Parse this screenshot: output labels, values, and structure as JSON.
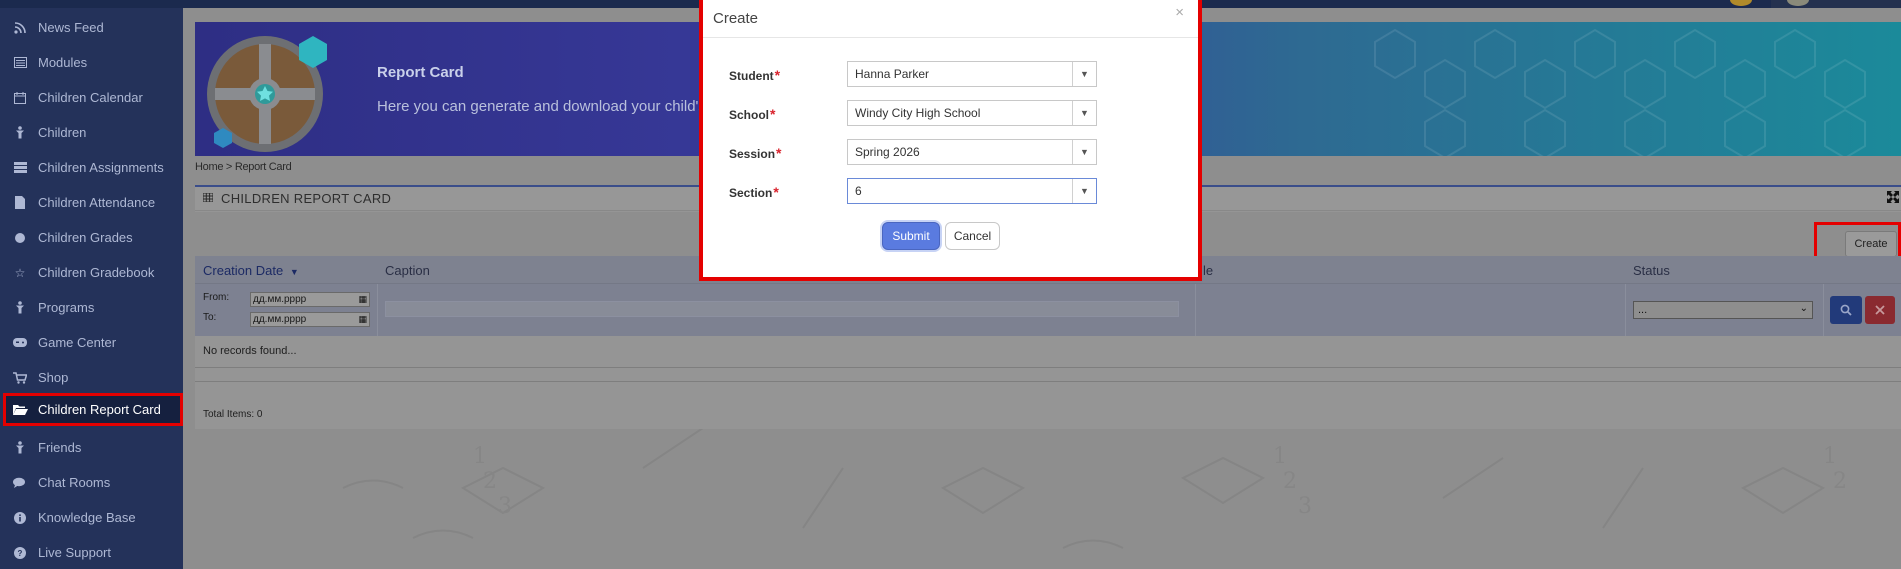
{
  "sidebar": {
    "items": [
      {
        "label": "News Feed",
        "icon": "rss-icon"
      },
      {
        "label": "Modules",
        "icon": "modules-icon"
      },
      {
        "label": "Children Calendar",
        "icon": "calendar-icon"
      },
      {
        "label": "Children",
        "icon": "child-icon"
      },
      {
        "label": "Children Assignments",
        "icon": "assignments-icon"
      },
      {
        "label": "Children Attendance",
        "icon": "attendance-icon"
      },
      {
        "label": "Children Grades",
        "icon": "grades-icon"
      },
      {
        "label": "Children Gradebook",
        "icon": "star-icon"
      },
      {
        "label": "Programs",
        "icon": "programs-icon"
      },
      {
        "label": "Game Center",
        "icon": "gamepad-icon"
      },
      {
        "label": "Shop",
        "icon": "cart-icon"
      },
      {
        "label": "Children Report Card",
        "icon": "folder-open-icon",
        "active": true
      },
      {
        "label": "Friends",
        "icon": "friends-icon"
      },
      {
        "label": "Chat Rooms",
        "icon": "chat-icon"
      },
      {
        "label": "Knowledge Base",
        "icon": "info-icon"
      },
      {
        "label": "Live Support",
        "icon": "help-icon"
      }
    ]
  },
  "banner": {
    "title": "Report Card",
    "subtitle": "Here you can generate and download your child's"
  },
  "breadcrumb": {
    "home": "Home",
    "separator": ">",
    "current": "Report Card"
  },
  "panel": {
    "title": "CHILDREN REPORT CARD",
    "create_label": "Create",
    "columns": {
      "creation_date": "Creation Date",
      "caption": "Caption",
      "file": "le",
      "status": "Status"
    },
    "filter": {
      "from_label": "From:",
      "to_label": "To:",
      "from_placeholder": "дд.мм.рррр",
      "to_placeholder": "дд.мм.рррр",
      "status_value": "..."
    },
    "no_records": "No records found...",
    "total": "Total Items: 0"
  },
  "modal": {
    "title": "Create",
    "close": "×",
    "fields": [
      {
        "label": "Student",
        "value": "Hanna Parker"
      },
      {
        "label": "School",
        "value": "Windy City High School"
      },
      {
        "label": "Session",
        "value": "Spring 2026"
      },
      {
        "label": "Section",
        "value": "6"
      }
    ],
    "required_mark": "*",
    "submit_label": "Submit",
    "cancel_label": "Cancel"
  },
  "colors": {
    "sidebar_bg": "#24325a",
    "highlight": "#e40000",
    "submit": "#5a7be0",
    "required": "#d9232d"
  }
}
